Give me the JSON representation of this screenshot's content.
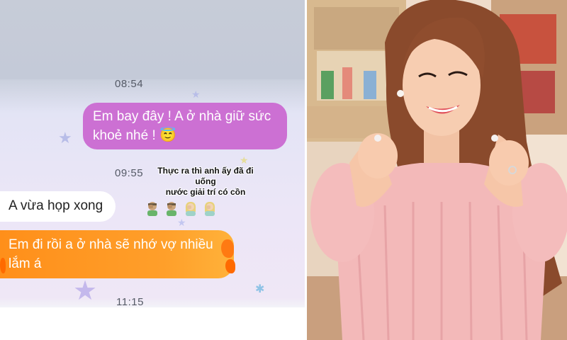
{
  "chat": {
    "timestamps": [
      "08:54",
      "09:55",
      "11:15"
    ],
    "messages": [
      {
        "sender": "me",
        "text_line1": "Em bay đây ! A ở nhà giữ sức",
        "text_line2": "khoẻ nhé ! 😇"
      },
      {
        "sender": "other",
        "text": "A vừa họp xong"
      },
      {
        "sender": "me",
        "text_line1": "Em đi rồi a ở nhà sẽ nhớ vợ nhiều",
        "text_line2": "lắm á"
      }
    ],
    "caption_line1": "Thực ra thì anh ấy đã đi uống",
    "caption_line2": "nước giải trí có cồn",
    "reaction_icons": [
      "man-facepalm-icon",
      "man-facepalm-icon",
      "woman-facepalm-icon",
      "woman-facepalm-icon"
    ]
  },
  "colors": {
    "sent_bubble": "#cc70d3",
    "orange_bubble": "#ff9322",
    "received_bubble": "#ffffff"
  }
}
